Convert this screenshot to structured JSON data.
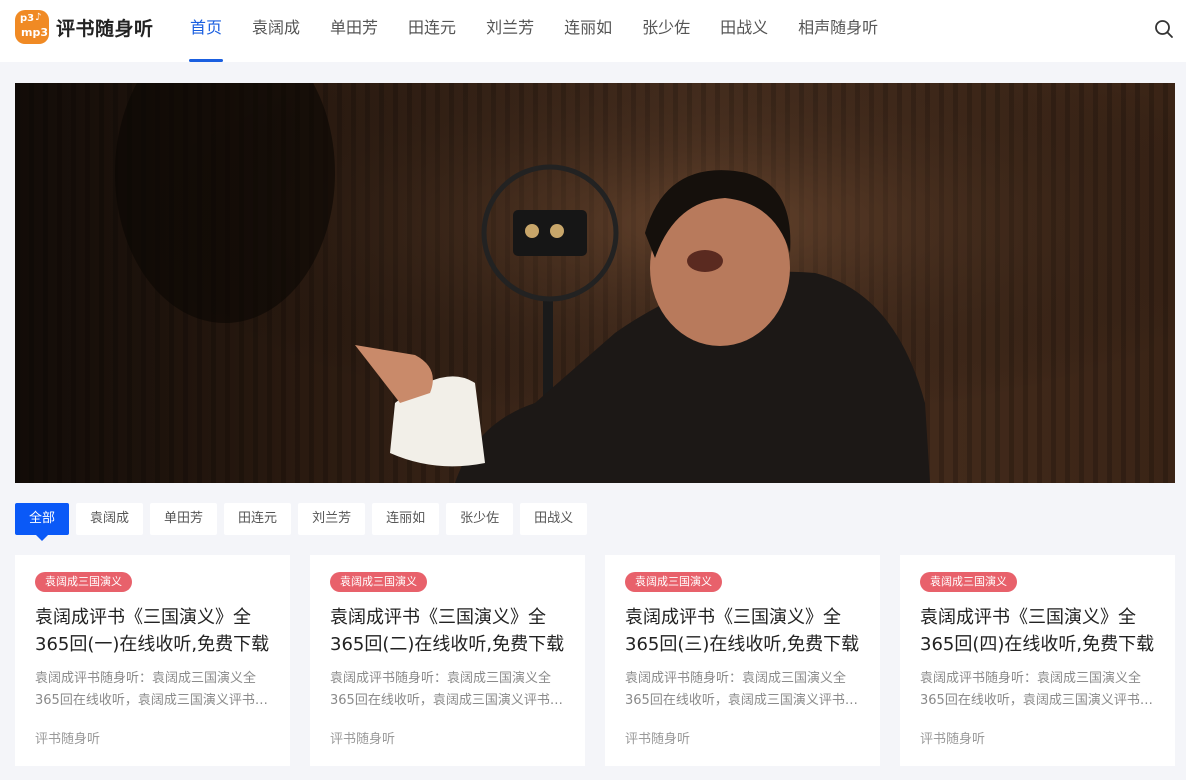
{
  "site": {
    "logo_line1": "p3",
    "logo_line2": "mp3",
    "title": "评书随身听"
  },
  "nav": {
    "items": [
      {
        "label": "首页",
        "active": true
      },
      {
        "label": "袁阔成"
      },
      {
        "label": "单田芳"
      },
      {
        "label": "田连元"
      },
      {
        "label": "刘兰芳"
      },
      {
        "label": "连丽如"
      },
      {
        "label": "张少佐"
      },
      {
        "label": "田战义"
      },
      {
        "label": "相声随身听"
      }
    ]
  },
  "filters": {
    "items": [
      "全部",
      "袁阔成",
      "单田芳",
      "田连元",
      "刘兰芳",
      "连丽如",
      "张少佐",
      "田战义"
    ]
  },
  "cards": [
    {
      "tag": "袁阔成三国演义",
      "title": "袁阔成评书《三国演义》全365回(一)在线收听,免费下载",
      "desc": "袁阔成评书随身听：袁阔成三国演义全365回在线收听，袁阔成三国演义评书免费下载",
      "source": "评书随身听"
    },
    {
      "tag": "袁阔成三国演义",
      "title": "袁阔成评书《三国演义》全365回(二)在线收听,免费下载",
      "desc": "袁阔成评书随身听：袁阔成三国演义全365回在线收听，袁阔成三国演义评书免费下载",
      "source": "评书随身听"
    },
    {
      "tag": "袁阔成三国演义",
      "title": "袁阔成评书《三国演义》全365回(三)在线收听,免费下载",
      "desc": "袁阔成评书随身听：袁阔成三国演义全365回在线收听，袁阔成三国演义评书免费下载",
      "source": "评书随身听"
    },
    {
      "tag": "袁阔成三国演义",
      "title": "袁阔成评书《三国演义》全365回(四)在线收听,免费下载",
      "desc": "袁阔成评书随身听：袁阔成三国演义全365回在线收听，袁阔成三国演义评书免费下载",
      "source": "评书随身听"
    }
  ],
  "colors": {
    "accent": "#1a5fe0",
    "filter_active": "#0a59f7",
    "tag": "#e8616b",
    "logo": "#f08a24"
  },
  "icons": {
    "search": "search-icon",
    "logo": "logo-icon"
  }
}
